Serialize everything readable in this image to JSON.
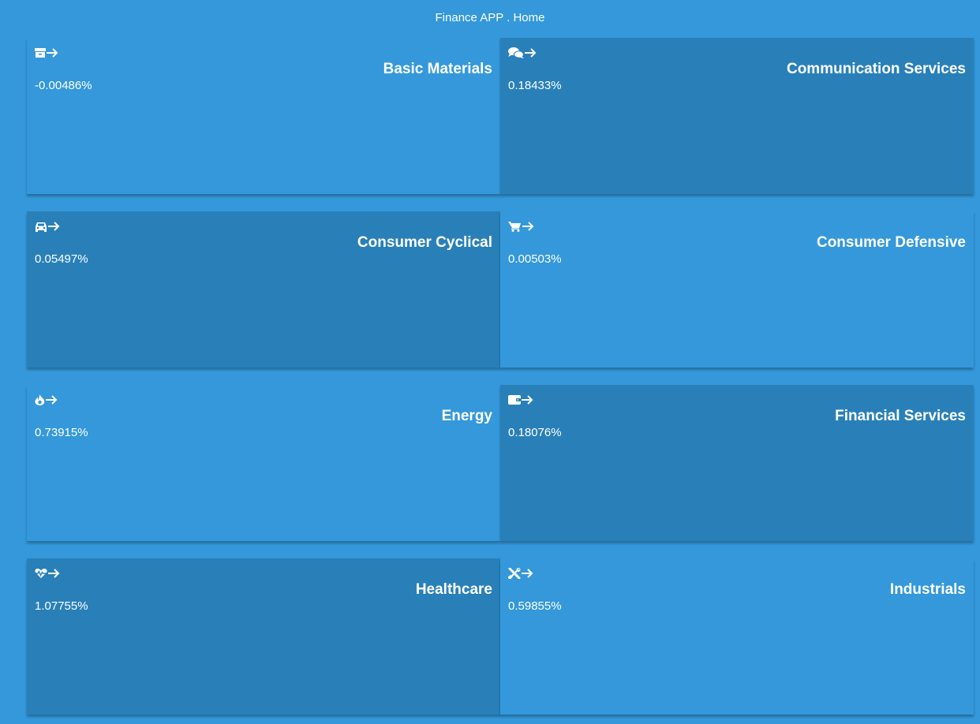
{
  "header": {
    "title": "Finance APP . Home"
  },
  "sectors": [
    {
      "name": "Basic Materials",
      "change": "-0.00486%",
      "icon": "box-icon",
      "shade": "light"
    },
    {
      "name": "Communication Services",
      "change": "0.18433%",
      "icon": "comments-icon",
      "shade": "dark"
    },
    {
      "name": "Consumer Cyclical",
      "change": "0.05497%",
      "icon": "car-icon",
      "shade": "dark"
    },
    {
      "name": "Consumer Defensive",
      "change": "0.00503%",
      "icon": "shopping-cart-icon",
      "shade": "light"
    },
    {
      "name": "Energy",
      "change": "0.73915%",
      "icon": "fire-icon",
      "shade": "light"
    },
    {
      "name": "Financial Services",
      "change": "0.18076%",
      "icon": "wallet-icon",
      "shade": "dark"
    },
    {
      "name": "Healthcare",
      "change": "1.07755%",
      "icon": "heartbeat-icon",
      "shade": "dark"
    },
    {
      "name": "Industrials",
      "change": "0.59855%",
      "icon": "tools-icon",
      "shade": "light"
    }
  ],
  "arrow_icon": "arrow-right-icon",
  "colors": {
    "background": "#3498db",
    "tile_light": "#3498db",
    "tile_dark": "#2980b9",
    "text": "#ffffff"
  }
}
